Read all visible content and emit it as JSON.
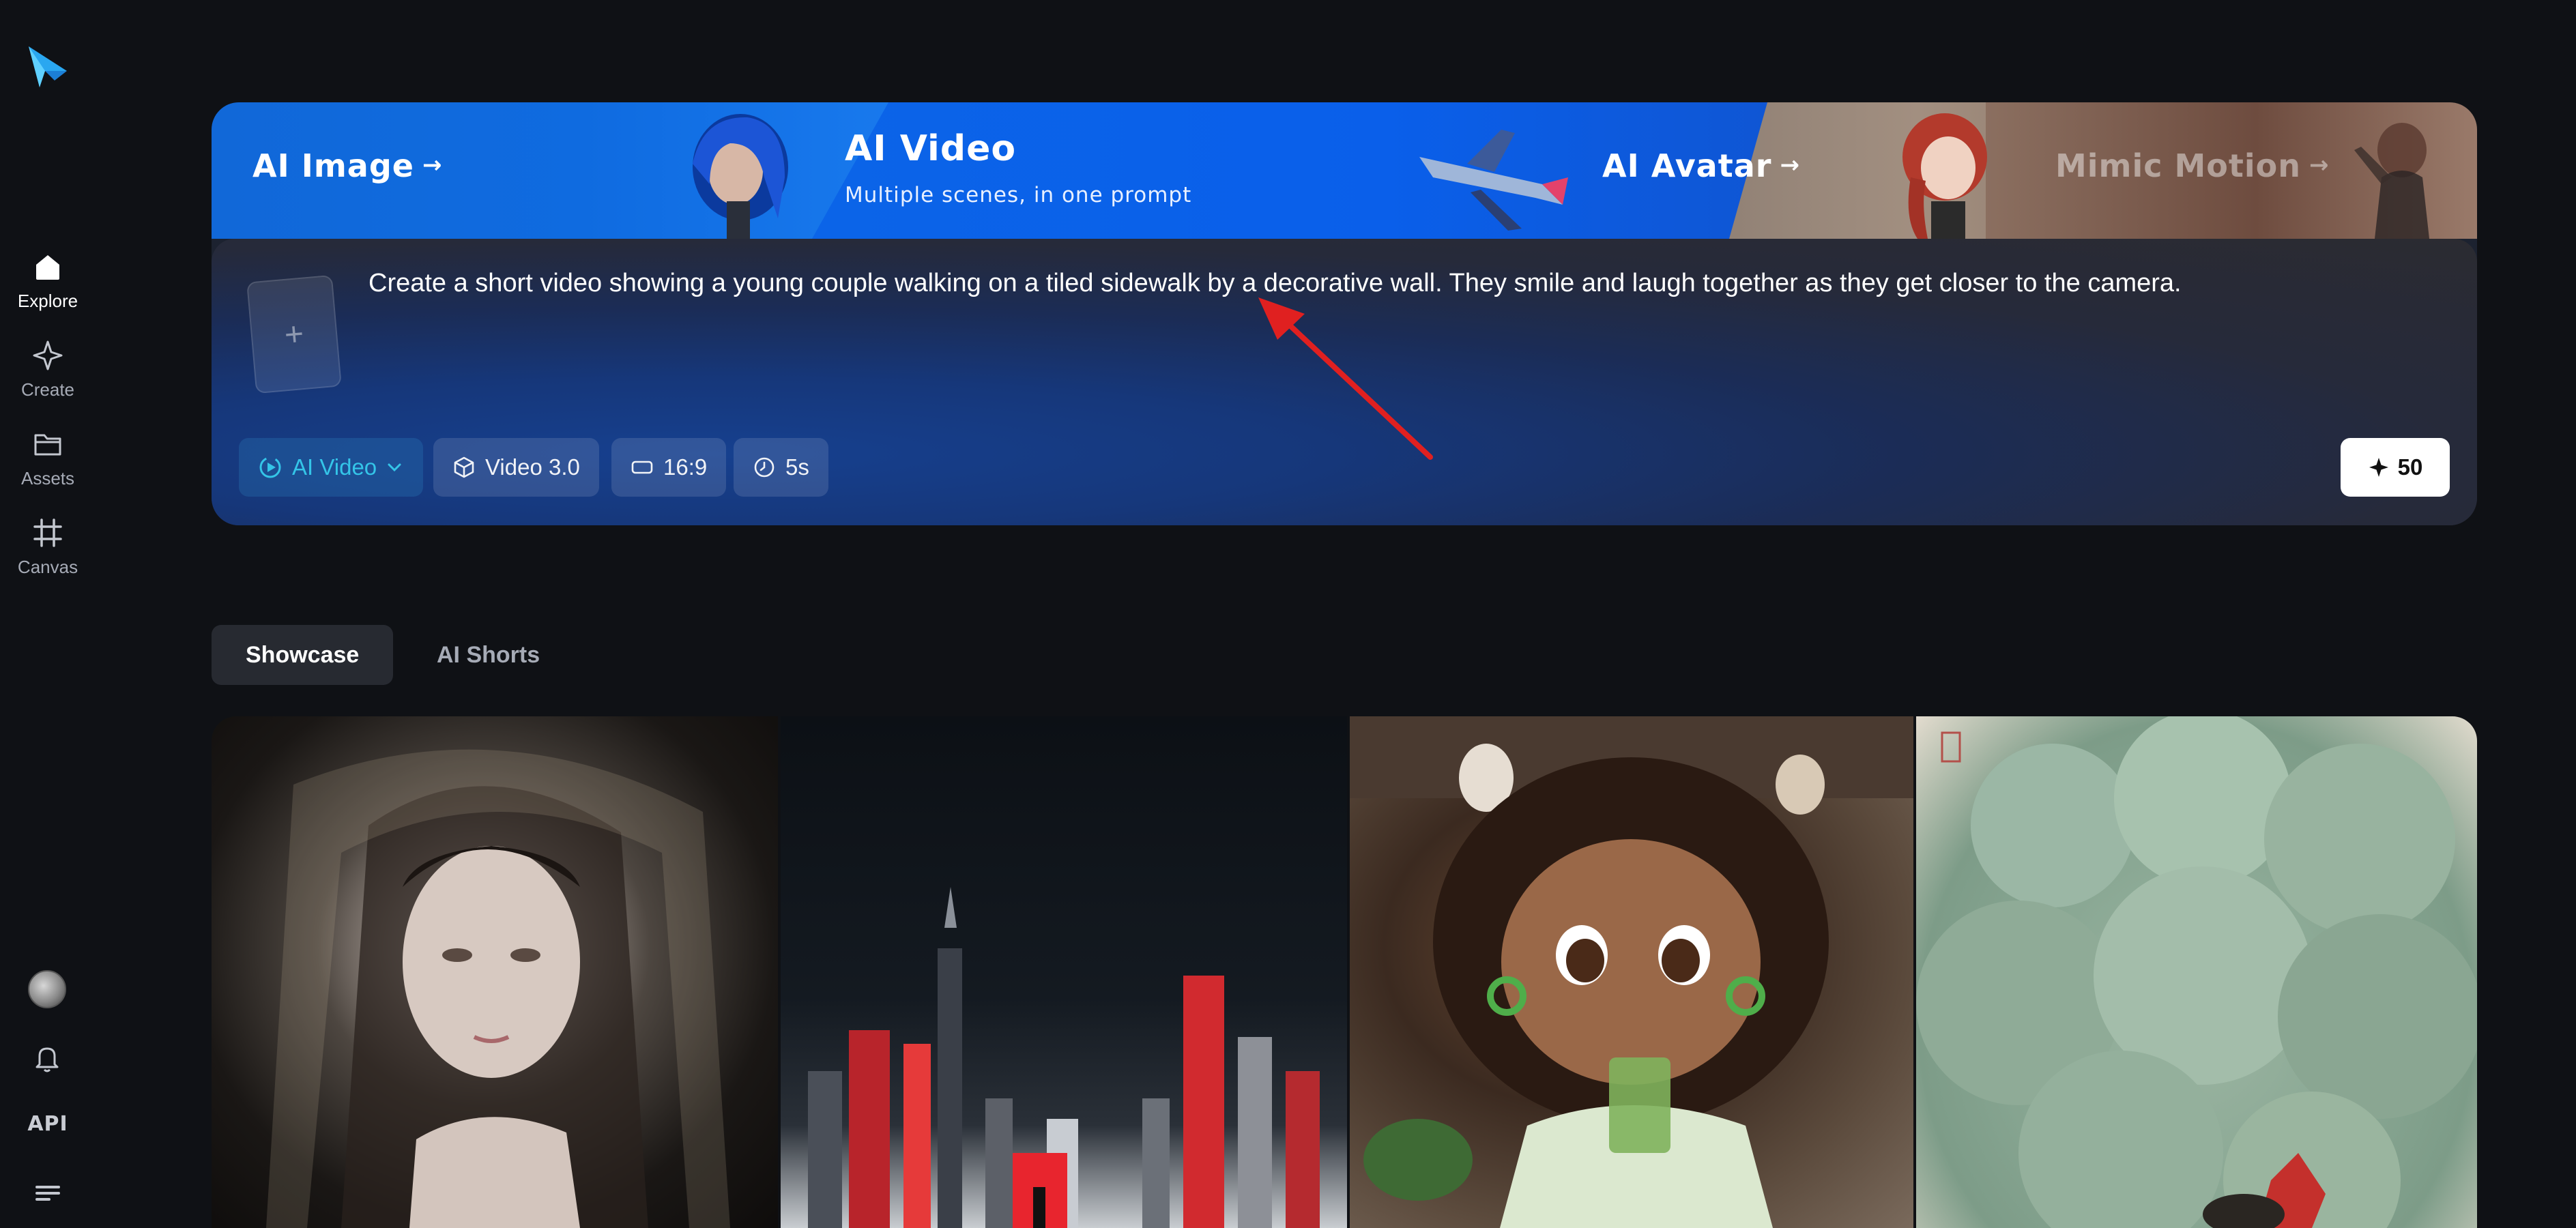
{
  "sidebar": {
    "items": [
      {
        "label": "Explore",
        "icon": "home-icon",
        "active": true
      },
      {
        "label": "Create",
        "icon": "sparkle-icon"
      },
      {
        "label": "Assets",
        "icon": "folder-icon"
      },
      {
        "label": "Canvas",
        "icon": "frame-grid-icon"
      }
    ],
    "api_label": "API"
  },
  "hero": {
    "tabs": [
      {
        "label": "AI Image",
        "arrow": "→"
      },
      {
        "label": "AI Video",
        "subtitle": "Multiple scenes, in one prompt",
        "active": true
      },
      {
        "label": "AI Avatar",
        "arrow": "→"
      },
      {
        "label": "Mimic Motion",
        "arrow": "→"
      }
    ],
    "upload_symbol": "+",
    "prompt": "Create a short video showing a young couple walking on a tiled sidewalk by a decorative wall. They smile and laugh together as they get closer to the camera.",
    "controls": {
      "mode": "AI Video",
      "model": "Video 3.0",
      "ratio": "16:9",
      "duration": "5s"
    },
    "credits": "50"
  },
  "sections": {
    "tabs": [
      {
        "label": "Showcase",
        "active": true
      },
      {
        "label": "AI Shorts"
      }
    ]
  },
  "colors": {
    "background": "#0f1115",
    "accent_blue": "#0b64e8",
    "mode_accent": "#34c5e8",
    "annotation": "#e02020"
  }
}
